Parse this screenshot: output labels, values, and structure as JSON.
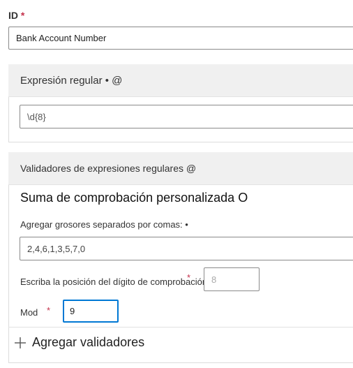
{
  "id_field": {
    "label": "ID",
    "required_mark": "*",
    "value": "Bank Account Number"
  },
  "regex_section": {
    "title": "Expresión regular • @",
    "value": "\\d{8}"
  },
  "validators_section": {
    "title": "Validadores de expresiones regulares @",
    "checksum_title": "Suma de comprobación personalizada O",
    "weights_label": "Agregar grosores separados por comas: •",
    "weights_value": "2,4,6,1,3,5,7,0",
    "check_digit_label": "Escriba la posición del dígito de comprobación:",
    "check_digit_required": "*",
    "check_digit_value": "8",
    "mod_label": "Mod",
    "mod_required": "*",
    "mod_value": "9",
    "add_validators_label": "Agregar validadores",
    "add_icon": "plus-icon"
  },
  "colors": {
    "accent": "#0078d4",
    "required": "#c4314b"
  }
}
